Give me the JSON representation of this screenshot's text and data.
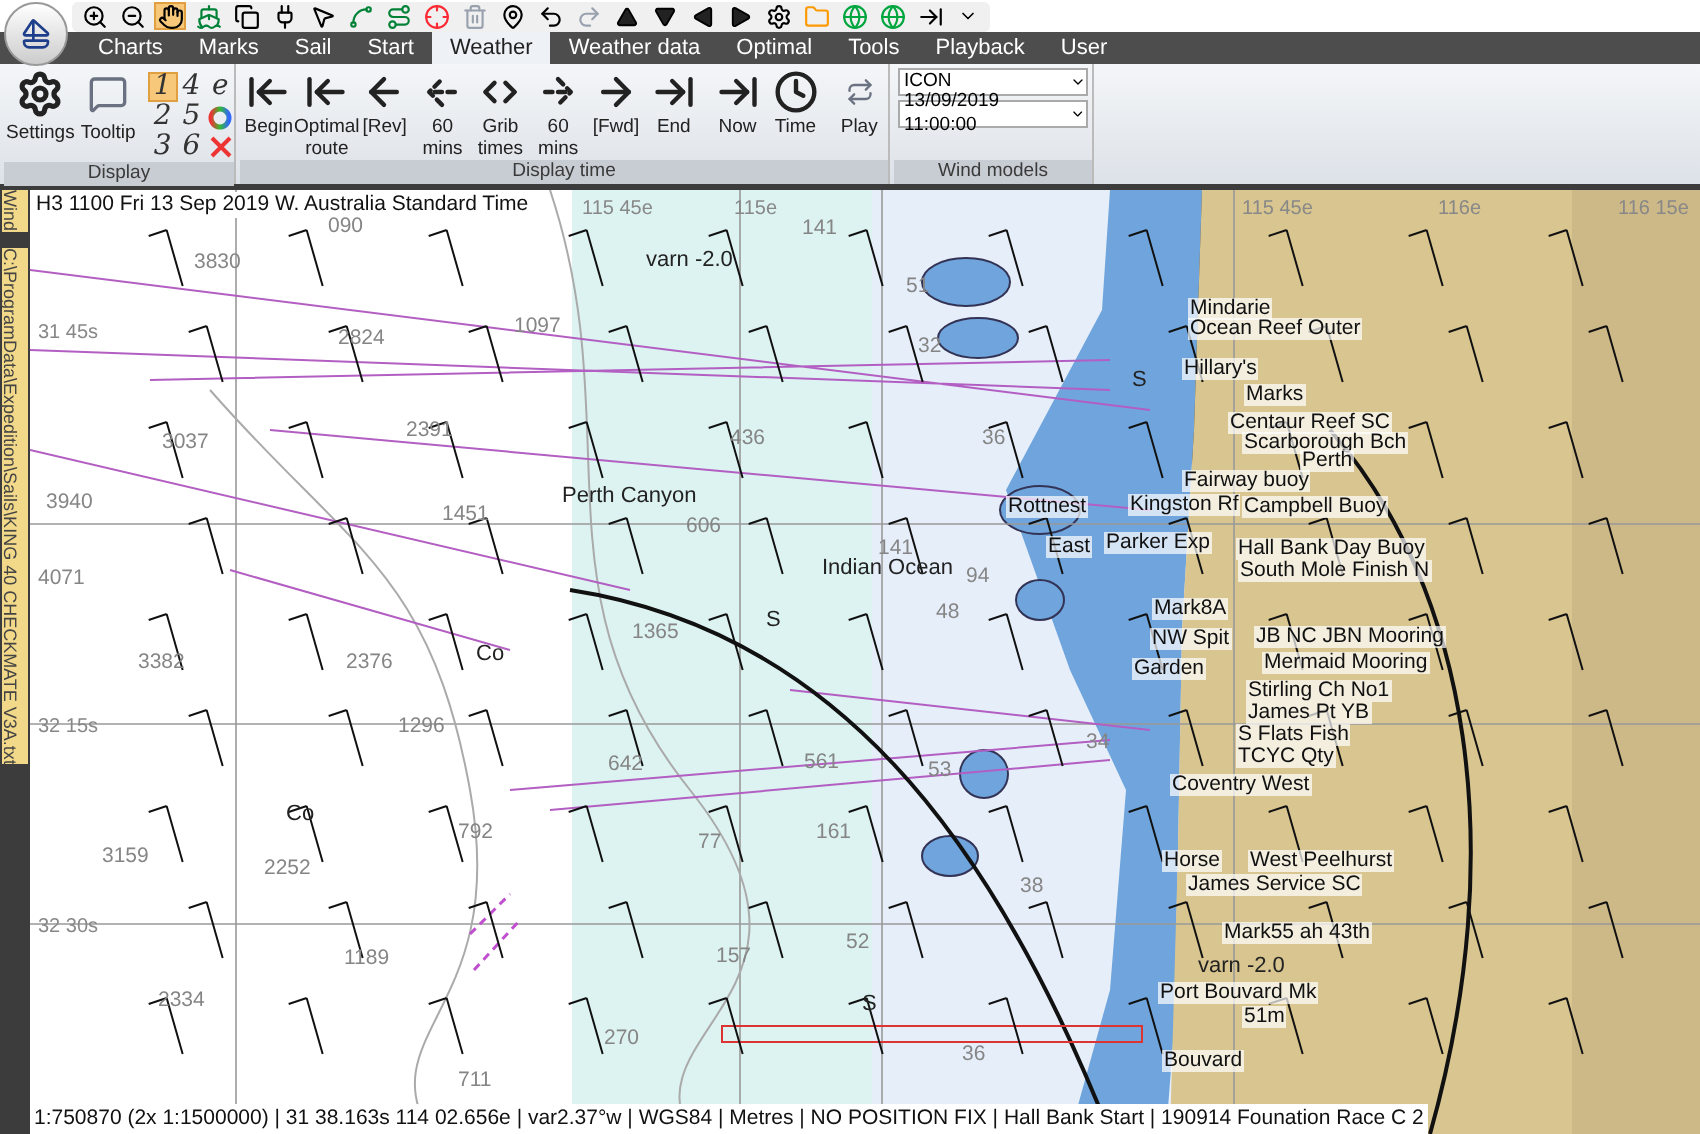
{
  "quick_access": [
    {
      "kind": "zoom-in",
      "selected": false
    },
    {
      "kind": "zoom-out",
      "selected": false
    },
    {
      "kind": "hand",
      "selected": true
    },
    {
      "kind": "boat",
      "selected": false
    },
    {
      "kind": "windows",
      "selected": false
    },
    {
      "kind": "plug",
      "selected": false
    },
    {
      "kind": "pointer",
      "selected": false
    },
    {
      "kind": "spline",
      "selected": false
    },
    {
      "kind": "route",
      "selected": false
    },
    {
      "kind": "target",
      "selected": false
    },
    {
      "kind": "trash",
      "selected": false
    },
    {
      "kind": "pin",
      "selected": false
    },
    {
      "kind": "undo",
      "selected": false
    },
    {
      "kind": "redo",
      "selected": false
    },
    {
      "kind": "up",
      "selected": false
    },
    {
      "kind": "down",
      "selected": false
    },
    {
      "kind": "left",
      "selected": false
    },
    {
      "kind": "right",
      "selected": false
    },
    {
      "kind": "gear",
      "selected": false
    },
    {
      "kind": "folder",
      "selected": false
    },
    {
      "kind": "globe",
      "selected": false
    },
    {
      "kind": "globe",
      "selected": false
    },
    {
      "kind": "end",
      "selected": false
    },
    {
      "kind": "more",
      "selected": false
    }
  ],
  "tabs": [
    {
      "label": "Charts",
      "selected": false
    },
    {
      "label": "Marks",
      "selected": false
    },
    {
      "label": "Sail",
      "selected": false
    },
    {
      "label": "Start",
      "selected": false
    },
    {
      "label": "Weather",
      "selected": true
    },
    {
      "label": "Weather data",
      "selected": false
    },
    {
      "label": "Optimal",
      "selected": false
    },
    {
      "label": "Tools",
      "selected": false
    },
    {
      "label": "Playback",
      "selected": false
    },
    {
      "label": "User",
      "selected": false
    }
  ],
  "ribbon": {
    "display": {
      "caption": "Display",
      "buttons": [
        {
          "kind": "settings",
          "label": "Settings"
        },
        {
          "kind": "tooltip",
          "label": "Tooltip"
        }
      ],
      "layers": [
        {
          "kind": "text",
          "label": "1",
          "selected": true
        },
        {
          "kind": "text",
          "label": "4",
          "selected": false
        },
        {
          "kind": "text",
          "label": "e",
          "selected": false
        },
        {
          "kind": "text",
          "label": "2",
          "selected": false
        },
        {
          "kind": "text",
          "label": "5",
          "selected": false
        },
        {
          "kind": "ring",
          "selected": false
        },
        {
          "kind": "text",
          "label": "3",
          "selected": false
        },
        {
          "kind": "text",
          "label": "6",
          "selected": false
        },
        {
          "kind": "delete",
          "selected": false
        }
      ]
    },
    "display_time": {
      "caption": "Display time",
      "buttons": [
        {
          "kind": "begin",
          "label": "Begin"
        },
        {
          "kind": "begin",
          "label": "Optimal route"
        },
        {
          "kind": "back",
          "label": "[Rev]"
        },
        {
          "kind": "back-dashed",
          "label": "60 mins"
        },
        {
          "kind": "both",
          "label": "Grib times"
        },
        {
          "kind": "fwd-dashed",
          "label": "60 mins"
        },
        {
          "kind": "fwd",
          "label": "[Fwd]"
        },
        {
          "kind": "end",
          "label": "End"
        },
        {
          "kind": "end",
          "label": "Now"
        },
        {
          "kind": "clock",
          "label": "Time"
        },
        {
          "kind": "play",
          "label": "Play"
        }
      ]
    },
    "wind_models": {
      "caption": "Wind models",
      "model": "ICON",
      "time": "13/09/2019 11:00:00"
    }
  },
  "side_tabs": [
    "Wind",
    "C:\\ProgramData\\Expedition\\Sails\\KING 40 CHECKMATE V3A.txt"
  ],
  "chart": {
    "header": "H3 1100 Fri 13 Sep 2019 W. Australia Standard Time",
    "labels": [
      {
        "kind": "grid",
        "text": "115 45e"
      },
      {
        "kind": "grid",
        "text": "115e"
      },
      {
        "kind": "grid",
        "text": "115 45e"
      },
      {
        "kind": "grid",
        "text": "116e"
      },
      {
        "kind": "grid",
        "text": "116 15e"
      },
      {
        "kind": "grid",
        "text": "31 45s"
      },
      {
        "kind": "grid",
        "text": "32 15s"
      },
      {
        "kind": "grid",
        "text": "32 30s"
      },
      {
        "kind": "depth",
        "text": "090"
      },
      {
        "kind": "depth",
        "text": "3830"
      },
      {
        "kind": "depth",
        "text": "141"
      },
      {
        "kind": "depth",
        "text": "2824"
      },
      {
        "kind": "depth",
        "text": "1097"
      },
      {
        "kind": "depth",
        "text": "51"
      },
      {
        "kind": "depth",
        "text": "32"
      },
      {
        "kind": "depth",
        "text": "3037"
      },
      {
        "kind": "depth",
        "text": "2391"
      },
      {
        "kind": "depth",
        "text": "436"
      },
      {
        "kind": "depth",
        "text": "36"
      },
      {
        "kind": "depth",
        "text": "3940"
      },
      {
        "kind": "depth",
        "text": "1451"
      },
      {
        "kind": "depth",
        "text": "606"
      },
      {
        "kind": "depth",
        "text": "4071"
      },
      {
        "kind": "depth",
        "text": "141"
      },
      {
        "kind": "depth",
        "text": "94"
      },
      {
        "kind": "depth",
        "text": "48"
      },
      {
        "kind": "depth",
        "text": "3382"
      },
      {
        "kind": "depth",
        "text": "2376"
      },
      {
        "kind": "depth",
        "text": "1365"
      },
      {
        "kind": "depth",
        "text": "1296"
      },
      {
        "kind": "depth",
        "text": "642"
      },
      {
        "kind": "depth",
        "text": "561"
      },
      {
        "kind": "depth",
        "text": "53"
      },
      {
        "kind": "depth",
        "text": "161"
      },
      {
        "kind": "depth",
        "text": "3159"
      },
      {
        "kind": "depth",
        "text": "2252"
      },
      {
        "kind": "depth",
        "text": "792"
      },
      {
        "kind": "depth",
        "text": "77"
      },
      {
        "kind": "depth",
        "text": "38"
      },
      {
        "kind": "depth",
        "text": "1189"
      },
      {
        "kind": "depth",
        "text": "157"
      },
      {
        "kind": "depth",
        "text": "52"
      },
      {
        "kind": "depth",
        "text": "2334"
      },
      {
        "kind": "depth",
        "text": "711"
      },
      {
        "kind": "depth",
        "text": "270"
      },
      {
        "kind": "depth",
        "text": "36"
      },
      {
        "kind": "depth",
        "text": "34"
      },
      {
        "kind": "area",
        "text": "varn -2.0"
      },
      {
        "kind": "area",
        "text": "Perth Canyon"
      },
      {
        "kind": "area",
        "text": "Indian Ocean"
      },
      {
        "kind": "area",
        "text": "Co"
      },
      {
        "kind": "area",
        "text": "Co"
      },
      {
        "kind": "area",
        "text": "S"
      },
      {
        "kind": "area",
        "text": "S"
      },
      {
        "kind": "area",
        "text": "S"
      },
      {
        "kind": "place",
        "text": "Mindarie"
      },
      {
        "kind": "place",
        "text": "Ocean Reef Outer"
      },
      {
        "kind": "place",
        "text": "Hillary's"
      },
      {
        "kind": "place",
        "text": "Marks"
      },
      {
        "kind": "place",
        "text": "Centaur Reef SC"
      },
      {
        "kind": "place",
        "text": "Scarborough Bch"
      },
      {
        "kind": "place",
        "text": "Perth"
      },
      {
        "kind": "place",
        "text": "Fairway buoy"
      },
      {
        "kind": "place",
        "text": "Rottnest"
      },
      {
        "kind": "place",
        "text": "Kingston Rf"
      },
      {
        "kind": "place",
        "text": "Campbell Buoy"
      },
      {
        "kind": "place",
        "text": "East"
      },
      {
        "kind": "place",
        "text": "Parker Exp"
      },
      {
        "kind": "place",
        "text": "Hall Bank Day Buoy"
      },
      {
        "kind": "place",
        "text": "South Mole Finish N"
      },
      {
        "kind": "place",
        "text": "Mark8A"
      },
      {
        "kind": "place",
        "text": "NW Spit"
      },
      {
        "kind": "place",
        "text": "JB NC JBN Mooring"
      },
      {
        "kind": "place",
        "text": "Garden"
      },
      {
        "kind": "place",
        "text": "Mermaid Mooring"
      },
      {
        "kind": "place",
        "text": "Stirling Ch No1"
      },
      {
        "kind": "place",
        "text": "James Pt YB"
      },
      {
        "kind": "place",
        "text": "S Flats Fish"
      },
      {
        "kind": "place",
        "text": "TCYC Qty"
      },
      {
        "kind": "place",
        "text": "Coventry West"
      },
      {
        "kind": "place",
        "text": "Horse"
      },
      {
        "kind": "place",
        "text": "West Peelhurst"
      },
      {
        "kind": "place",
        "text": "James Service SC"
      },
      {
        "kind": "place",
        "text": "Mark55 ah 43th"
      },
      {
        "kind": "area",
        "text": "varn -2.0"
      },
      {
        "kind": "place",
        "text": "Port Bouvard Mk"
      },
      {
        "kind": "place",
        "text": "51m"
      },
      {
        "kind": "place",
        "text": "Bouvard"
      }
    ]
  },
  "status_bar": "1:750870 (2x 1:1500000) | 31 38.163s 114 02.656e | var2.37°w | WGS84 | Metres | NO POSITION FIX | Hall Bank Start | 190914 Founation Race C 2"
}
